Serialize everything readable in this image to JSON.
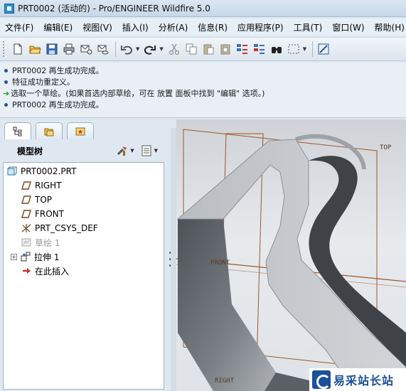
{
  "window": {
    "title": "PRT0002 (活动的) - Pro/ENGINEER Wildfire 5.0"
  },
  "menu": [
    "文件(F)",
    "编辑(E)",
    "视图(V)",
    "插入(I)",
    "分析(A)",
    "信息(R)",
    "应用程序(P)",
    "工具(T)",
    "窗口(W)",
    "帮助(H)"
  ],
  "toolbar": {
    "icons": [
      "new-icon",
      "open-icon",
      "save-icon",
      "print-icon",
      "email-icon",
      "email-link-icon",
      "undo-icon",
      "redo-icon",
      "cut-icon",
      "copy-icon",
      "paste-icon",
      "paste-special-icon",
      "regenerate-icon",
      "regenerate-manager-icon",
      "find-icon",
      "select-box-icon",
      "sketch-tool-icon"
    ]
  },
  "messages": [
    {
      "type": "info",
      "text": "PRT0002 再生成功完成。"
    },
    {
      "type": "info",
      "text": "特征成功重定义。"
    },
    {
      "type": "prompt",
      "text": "选取一个草绘。(如果首选内部草绘，可在 放置 面板中找到 \"编辑\" 选项。)"
    },
    {
      "type": "info",
      "text": "PRT0002 再生成功完成。"
    }
  ],
  "panel": {
    "tabs": [
      "model-tree-tab-icon",
      "folder-browser-tab-icon",
      "favorites-tab-icon"
    ],
    "title": "模型树",
    "tree": [
      {
        "label": "PRT0002.PRT",
        "icon": "part-icon",
        "dim": false,
        "expander": false
      },
      {
        "label": "RIGHT",
        "icon": "datum-plane-icon",
        "dim": false,
        "expander": false
      },
      {
        "label": "TOP",
        "icon": "datum-plane-icon",
        "dim": false,
        "expander": false
      },
      {
        "label": "FRONT",
        "icon": "datum-plane-icon",
        "dim": false,
        "expander": false
      },
      {
        "label": "PRT_CSYS_DEF",
        "icon": "csys-icon",
        "dim": false,
        "expander": false
      },
      {
        "label": "草绘 1",
        "icon": "sketch-icon",
        "dim": true,
        "expander": false
      },
      {
        "label": "拉伸 1",
        "icon": "extrude-icon",
        "dim": false,
        "expander": true
      },
      {
        "label": "在此插入",
        "icon": "insert-here-icon",
        "dim": false,
        "expander": false
      }
    ]
  },
  "viewport": {
    "datum_labels": {
      "top": "TOP",
      "front": "FRONT",
      "right": "RIGHT"
    },
    "watermark": "易采站长站"
  },
  "colors": {
    "datum": "#a0562a",
    "message_prompt": "#1c9c2c",
    "bullet": "#2053a8"
  }
}
